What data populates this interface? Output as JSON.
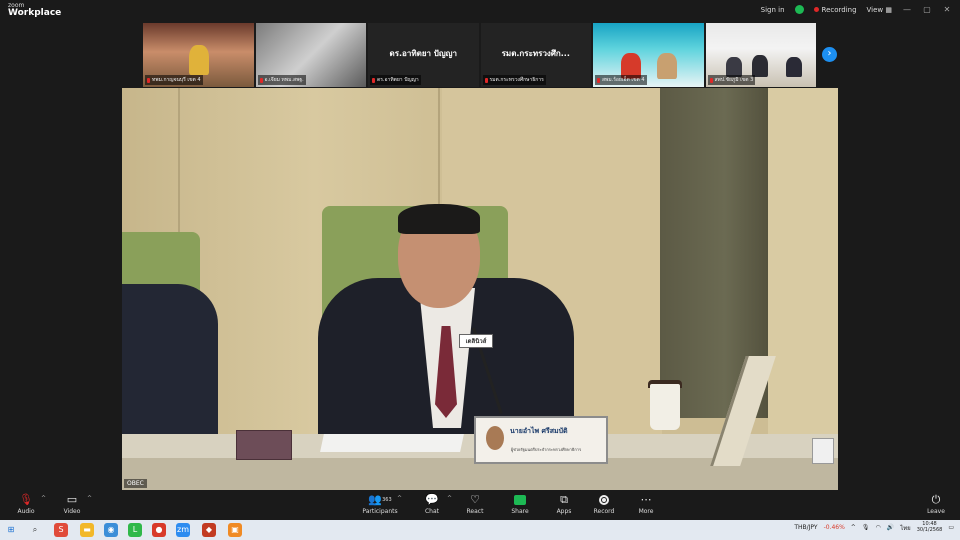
{
  "titlebar": {
    "logo_line1": "zoom",
    "logo_line2": "Workplace",
    "signin": "Sign in",
    "recording": "Recording",
    "view": "View",
    "minimize_icon": "minimize-icon",
    "maximize_icon": "maximize-icon",
    "close_icon": "close-icon"
  },
  "thumbnails": [
    {
      "name": "ทพม.กาญจนบุรี เขต 4",
      "type": "video"
    },
    {
      "name": "อ.เจียม ทพม.สพฐ.",
      "type": "video"
    },
    {
      "name": "ดร.อาทิตยา ปัญญา",
      "display": "ดร.อาทิตยา ปัญญา",
      "type": "name"
    },
    {
      "name": "รมต.กระทรวงศึกษาธิการ",
      "display": "รมต.กระทรวงศึก...",
      "type": "name"
    },
    {
      "name": "สพม.ร้อยเอ็ด เขต 4",
      "type": "video"
    },
    {
      "name": "สพป.ชัยภูมิ เขต 3",
      "type": "video"
    }
  ],
  "main_video": {
    "mic_tag": "เดลินิวส์",
    "nameplate_name": "นายอำไพ ศรีสมบัติ",
    "nameplate_title": "ผู้ช่วยรัฐมนตรีประจำกระทรวงศึกษาธิการ",
    "watermark": "OBEC"
  },
  "toolbar": {
    "audio": "Audio",
    "video": "Video",
    "participants": "Participants",
    "participants_count": "363",
    "chat": "Chat",
    "react": "React",
    "share": "Share",
    "apps": "Apps",
    "record": "Record",
    "more": "More",
    "leave": "Leave"
  },
  "taskbar": {
    "ticker": "THB/JPY",
    "ticker_change": "-0.46%",
    "lang": "ไทย",
    "time": "10:48",
    "date": "30/1/2568"
  },
  "colors": {
    "accent_blue": "#1d8ff0",
    "recording_red": "#e02828",
    "share_green": "#1db954"
  }
}
